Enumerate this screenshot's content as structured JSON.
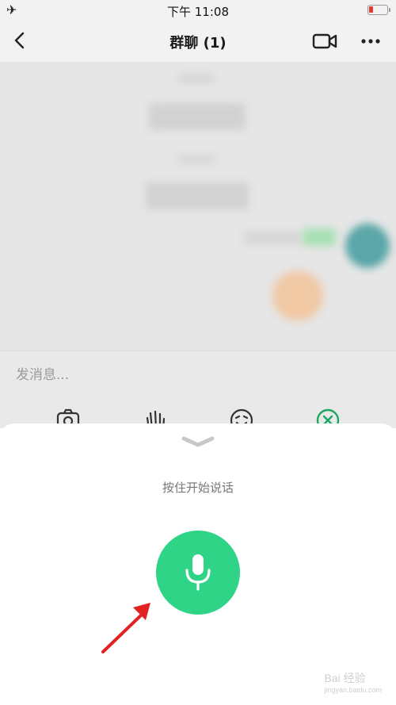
{
  "status_bar": {
    "time": "下午 11:08",
    "airplane_glyph": "✈",
    "battery_color": "#e53935"
  },
  "nav": {
    "title": "群聊 (1)",
    "icons": [
      "back-arrow-icon",
      "video-camera-icon",
      "more-icon"
    ]
  },
  "message_bar": {
    "placeholder": "发消息...",
    "tools": [
      "camera-icon",
      "wave-hand-icon",
      "emoji-icon",
      "close-circle-icon"
    ]
  },
  "voice_sheet": {
    "hint": "按住开始说话",
    "accent": "#2fd487"
  },
  "watermark": {
    "text": "Bai 经验",
    "domain": "jingyan.baidu.com"
  }
}
